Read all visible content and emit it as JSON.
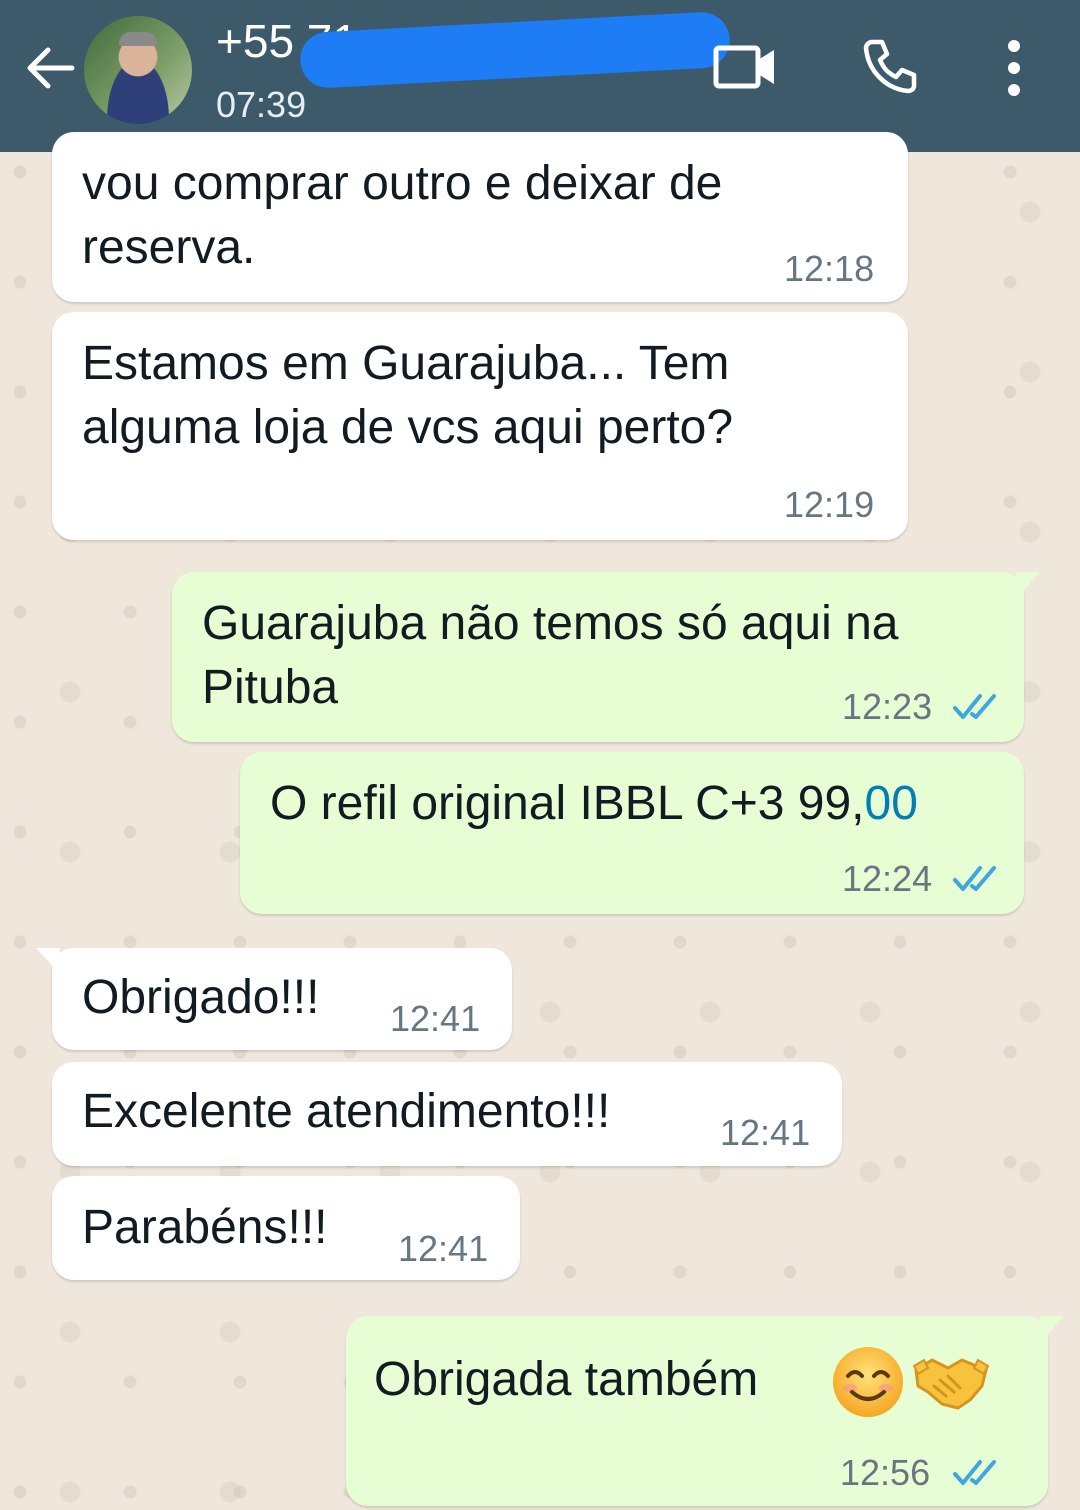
{
  "header": {
    "back_icon": "arrow-left-icon",
    "contact_name": "+55 71 ",
    "status": "07:39",
    "video_icon": "video-call-icon",
    "call_icon": "phone-icon",
    "menu_icon": "more-vertical-icon",
    "bg_color": "#3d5a6a"
  },
  "messages": [
    {
      "side": "in",
      "lines": [
        "vou comprar outro e deixar de",
        "reserva."
      ],
      "time": "12:18"
    },
    {
      "side": "in",
      "lines": [
        "Estamos em Guarajuba... Tem",
        "alguma loja de vcs aqui perto?"
      ],
      "time": "12:19"
    },
    {
      "side": "out",
      "lines": [
        "Guarajuba não temos só aqui na",
        "Pituba"
      ],
      "time": "12:23",
      "status": "read"
    },
    {
      "side": "out",
      "text_main": "O refil original IBBL C+3 99,",
      "text_accent": "00",
      "time": "12:24",
      "status": "read"
    },
    {
      "side": "in",
      "text": "Obrigado!!!",
      "time": "12:41"
    },
    {
      "side": "in",
      "text": "Excelente atendimento!!!",
      "time": "12:41"
    },
    {
      "side": "in",
      "text": "Parabéns!!!",
      "time": "12:41"
    },
    {
      "side": "out",
      "text": "Obrigada também",
      "emojis": [
        "smiling-face-emoji",
        "handshake-emoji"
      ],
      "time": "12:56",
      "status": "read"
    }
  ],
  "colors": {
    "incoming": "#ffffff",
    "outgoing": "#e7fdd3",
    "read_ticks": "#3fa6e0",
    "accent_link": "#027eb5"
  }
}
